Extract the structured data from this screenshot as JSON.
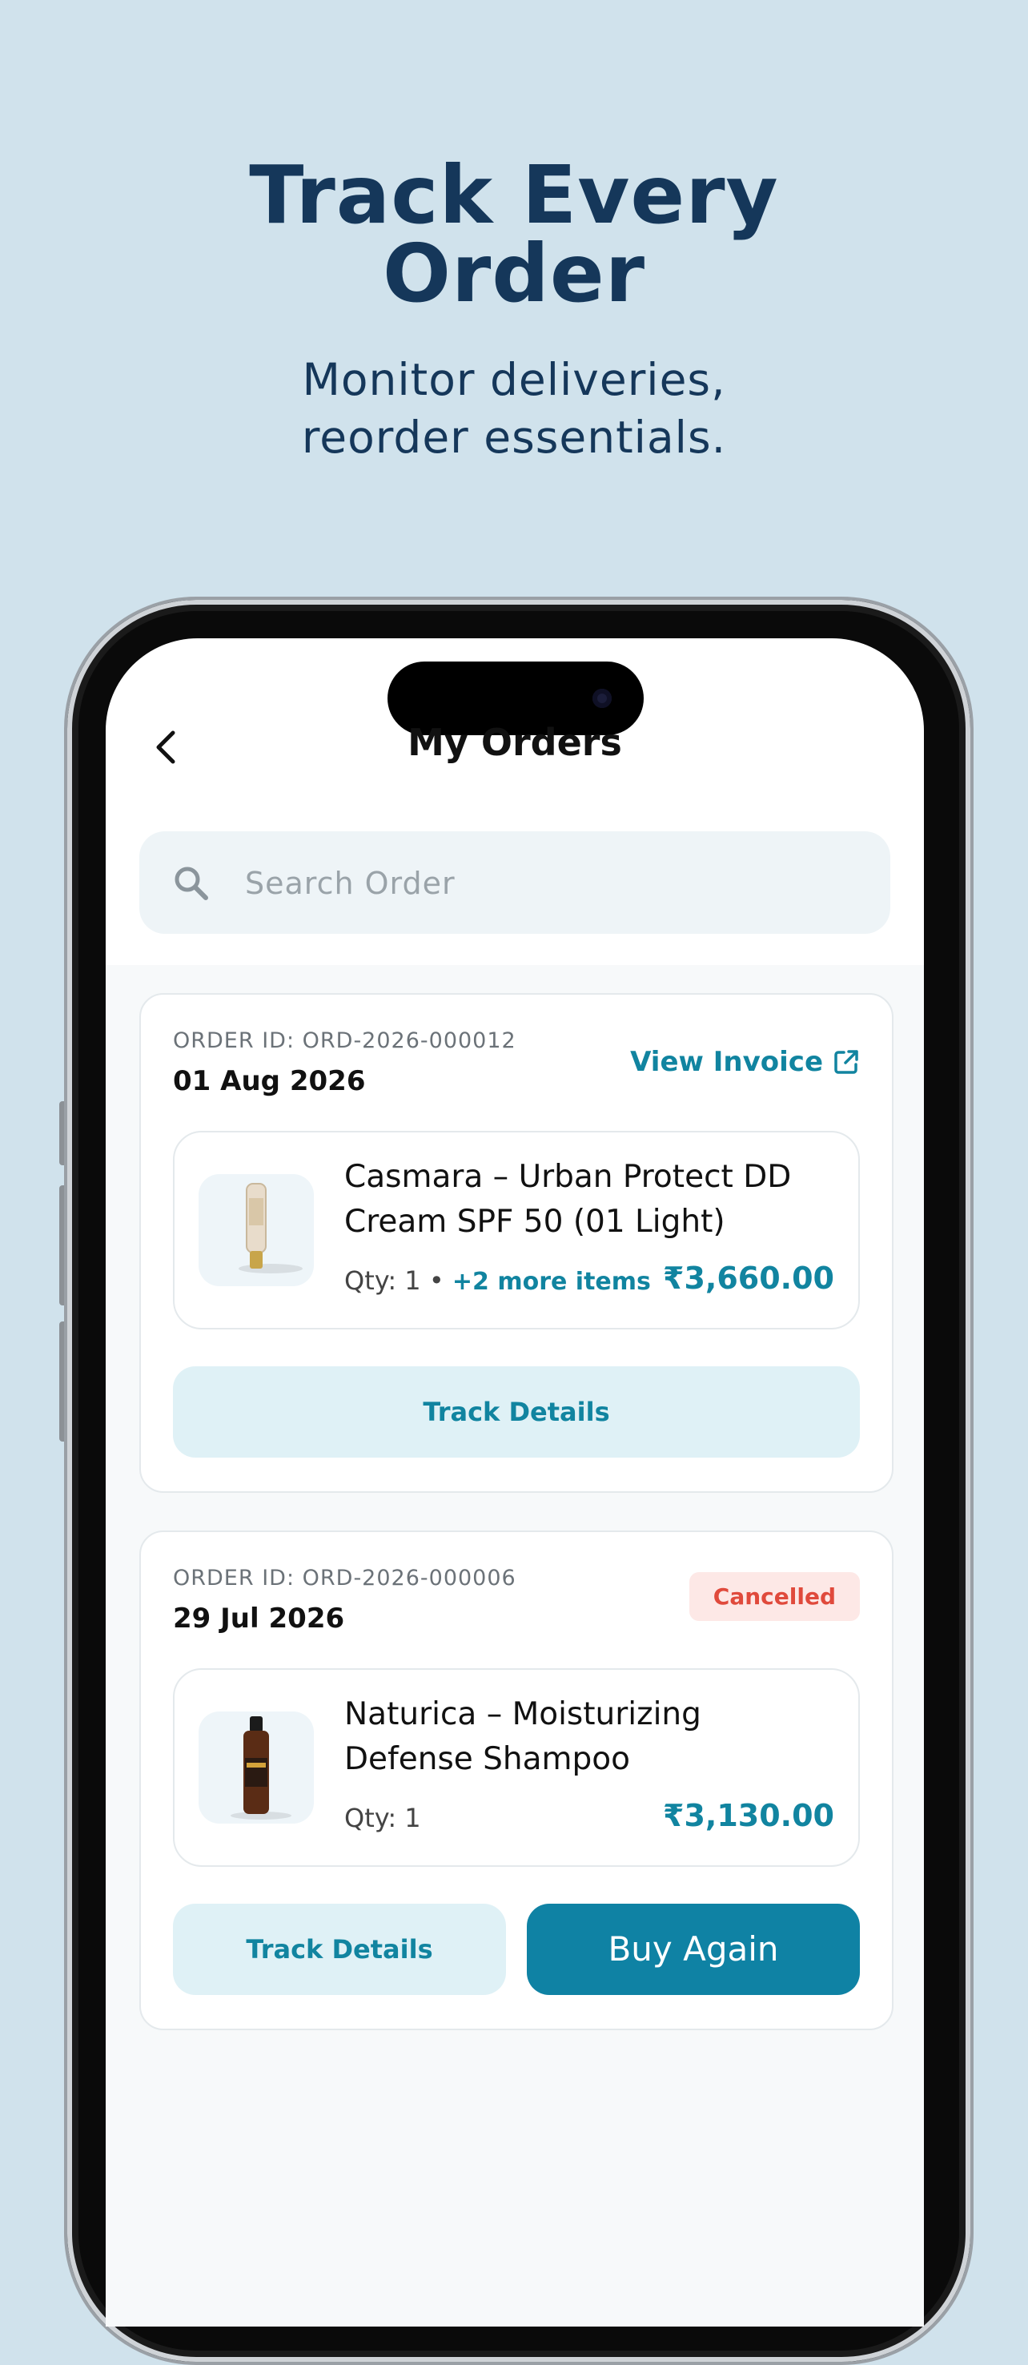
{
  "hero": {
    "title_line1": "Track Every",
    "title_line2": "Order",
    "subtitle_line1": "Monitor deliveries,",
    "subtitle_line2": "reorder essentials."
  },
  "header": {
    "title": "My Orders"
  },
  "search": {
    "placeholder": "Search Order",
    "value": ""
  },
  "orders": [
    {
      "order_id": "ORDER ID: ORD-2026-000012",
      "date": "01 Aug 2026",
      "invoice_label": "View Invoice",
      "item": {
        "name": "Casmara – Urban Protect DD Cream SPF 50 (01 Light)",
        "qty": "Qty: 1",
        "separator": "•",
        "more_items": "+2 more items",
        "price": "₹3,660.00"
      },
      "track_label": "Track Details"
    },
    {
      "order_id": "ORDER ID: ORD-2026-000006",
      "date": "29 Jul 2026",
      "status": "Cancelled",
      "item": {
        "name": "Naturica – Moisturizing Defense Shampoo",
        "qty": "Qty: 1",
        "price": "₹3,130.00"
      },
      "track_label": "Track Details",
      "buy_again_label": "Buy Again"
    }
  ],
  "colors": {
    "background": "#d0e2ec",
    "hero_text": "#15375a",
    "accent": "#1184a0",
    "accent_dark": "#0f82a4",
    "cancelled": "#e04a3c"
  },
  "icons": {
    "back": "chevron-left-icon",
    "search": "search-icon",
    "invoice": "external-link-icon"
  }
}
